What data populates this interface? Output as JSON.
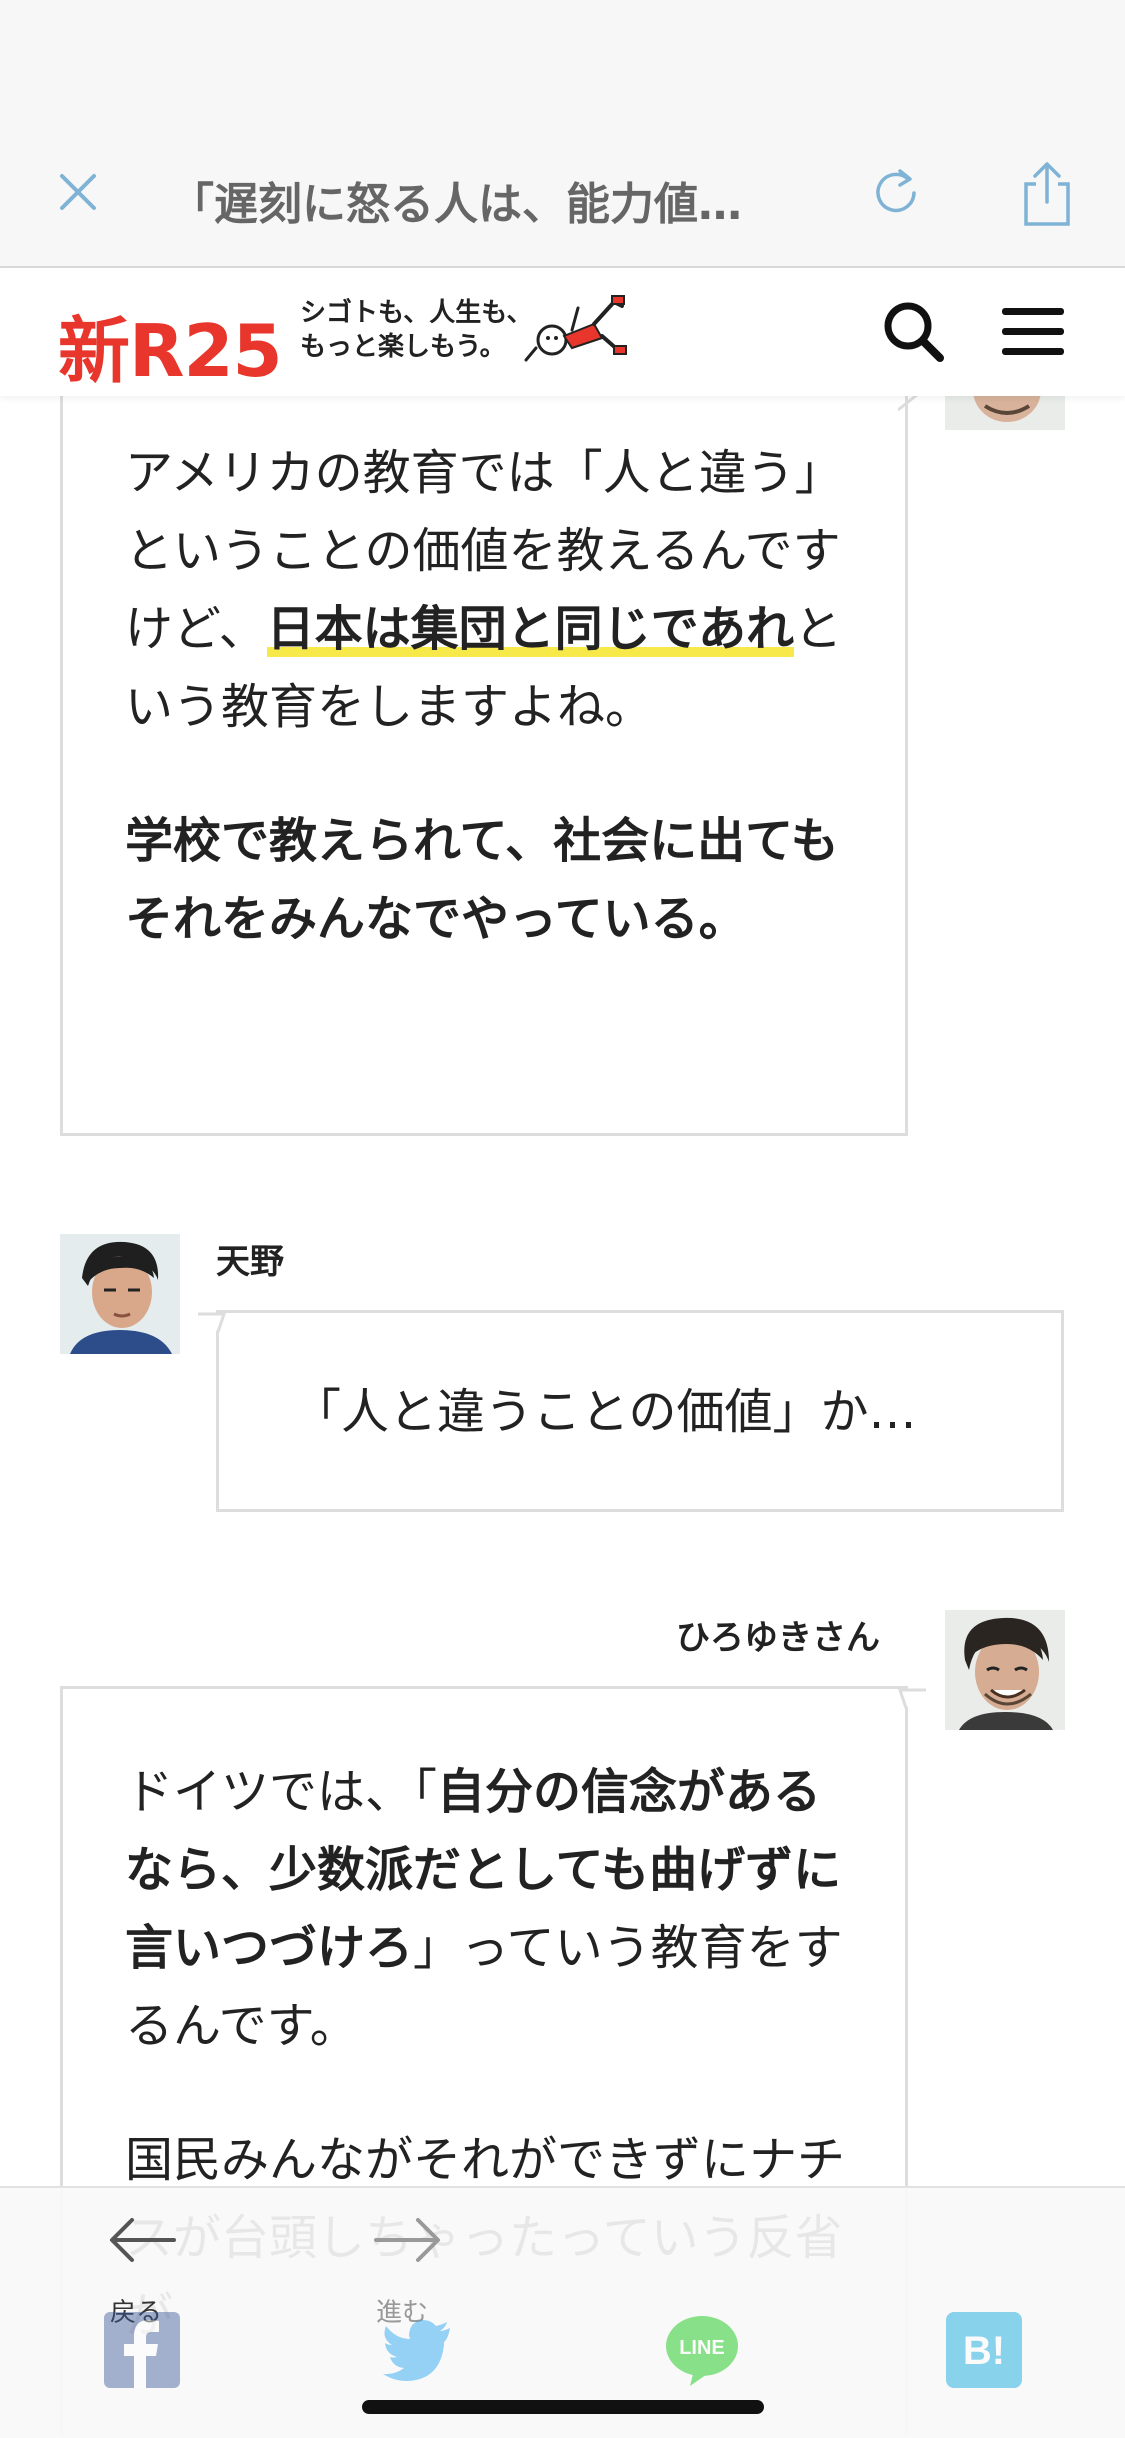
{
  "browser": {
    "title": "「遅刻に怒る人は、能力値…"
  },
  "site": {
    "logo": "新R25",
    "tagline_line1": "シゴトも、人生も、",
    "tagline_line2": "もっと楽しもう。"
  },
  "conversation": {
    "bubble1": {
      "p1_a": "アメリカの教育では「人と違う」ということの価値を教えるんですけど、",
      "p1_highlight": "日本は集団と同じであれ",
      "p1_b": "という教育をしますよね。",
      "p2": "学校で教えられて、社会に出てもそれをみんなでやっている。"
    },
    "amano": {
      "name": "天野",
      "text": "「人と違うことの価値」か…"
    },
    "hiroyuki": {
      "name": "ひろゆきさん",
      "p1_a": "ドイツでは、「",
      "p1_bold": "自分の信念があるなら、少数派だとしても曲げずに言いつづけろ",
      "p1_b": "」っていう教育をするんです。",
      "p2": "国民みんながそれができずにナチスが台頭しちゃったっていう反省が"
    }
  },
  "toolbar": {
    "back_label": "戻る",
    "forward_label": "進む",
    "line_label": "LINE",
    "hatena_label": "B!"
  },
  "colors": {
    "brand_red": "#e8362c",
    "highlight_yellow": "#f7e94a",
    "browser_icon_blue": "#7fb3d5"
  }
}
